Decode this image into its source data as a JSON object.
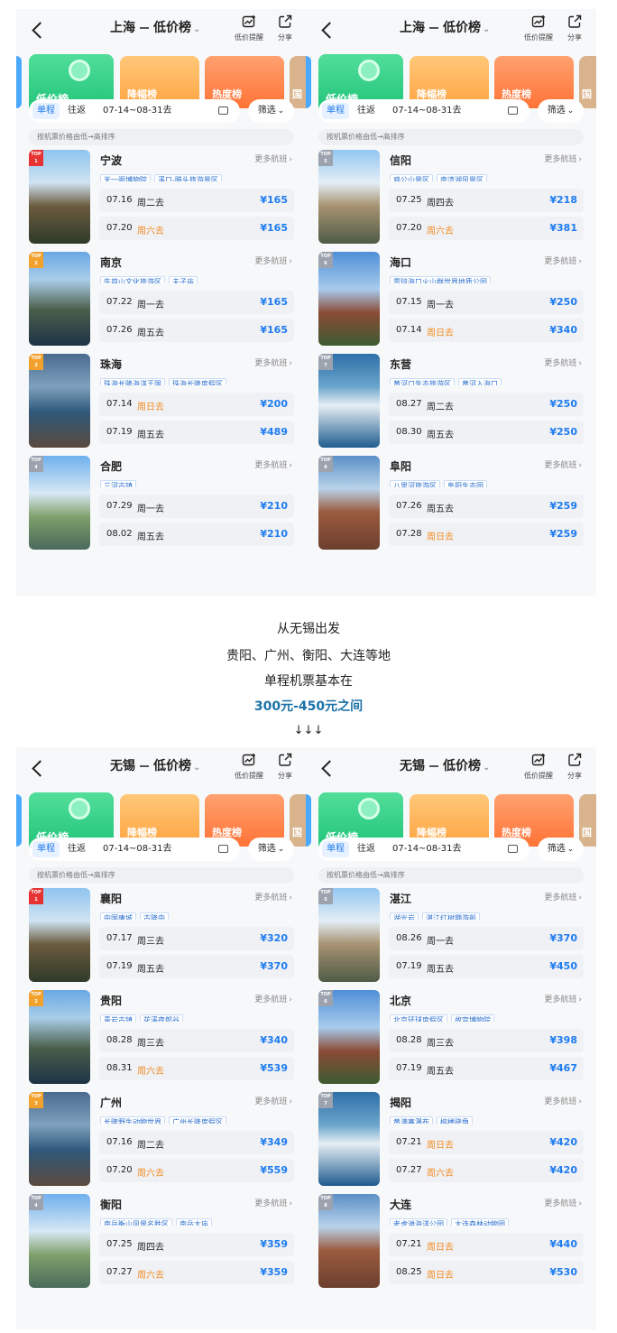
{
  "ui": {
    "rank_top": "TOP",
    "more_flights": "更多航班",
    "trip_one_way": "单程",
    "trip_round": "往返",
    "screen_label": "筛选",
    "sort_text": "按机票价格由低→高排序",
    "alert_label": "低价提醒",
    "share_label": "分享",
    "card_low": "低价榜",
    "card_drop": "降幅榜",
    "card_hot": "热度榜",
    "card_more": "国",
    "dash": "—",
    "chevron": "⌄"
  },
  "caption": {
    "line1": "从无锡出发",
    "line2": "贵阳、广州、衡阳、大连等地",
    "line3": "单程机票基本在",
    "line4": "300元-450元之间",
    "arrows": "↓↓↓"
  },
  "colors": {
    "accent": "#1f7cf0",
    "weekend": "#f38a1d",
    "highlight": "#1c72a8"
  },
  "panels": [
    {
      "id": "sh-left",
      "origin": "上海",
      "list_name": "低价榜",
      "dates": "07-14~08-31去",
      "items": [
        {
          "rank": "1",
          "city": "宁波",
          "tags": [
            "天一阁博物院",
            "溪口-滕头旅游景区"
          ],
          "flights": [
            {
              "date": "07.16",
              "weekday": "周二去",
              "price": "¥165",
              "weekend": false
            },
            {
              "date": "07.20",
              "weekday": "周六去",
              "price": "¥165",
              "weekend": true
            }
          ]
        },
        {
          "rank": "2",
          "city": "南京",
          "tags": [
            "牛首山文化旅游区",
            "夫子庙"
          ],
          "flights": [
            {
              "date": "07.22",
              "weekday": "周一去",
              "price": "¥165",
              "weekend": false
            },
            {
              "date": "07.26",
              "weekday": "周五去",
              "price": "¥165",
              "weekend": false
            }
          ]
        },
        {
          "rank": "3",
          "city": "珠海",
          "tags": [
            "珠海长隆海洋王国",
            "珠海长隆度假区"
          ],
          "flights": [
            {
              "date": "07.14",
              "weekday": "周日去",
              "price": "¥200",
              "weekend": true
            },
            {
              "date": "07.19",
              "weekday": "周五去",
              "price": "¥489",
              "weekend": false
            }
          ]
        },
        {
          "rank": "4",
          "city": "合肥",
          "tags": [
            "三河古镇"
          ],
          "flights": [
            {
              "date": "07.29",
              "weekday": "周一去",
              "price": "¥210",
              "weekend": false
            },
            {
              "date": "08.02",
              "weekday": "周五去",
              "price": "¥210",
              "weekend": false
            }
          ]
        }
      ]
    },
    {
      "id": "sh-right",
      "origin": "上海",
      "list_name": "低价榜",
      "dates": "07-14~08-31去",
      "items": [
        {
          "rank": "5",
          "city": "信阳",
          "tags": [
            "鸡公山景区",
            "南湾湖风景区"
          ],
          "flights": [
            {
              "date": "07.25",
              "weekday": "周四去",
              "price": "¥218",
              "weekend": false
            },
            {
              "date": "07.20",
              "weekday": "周六去",
              "price": "¥381",
              "weekend": true
            }
          ]
        },
        {
          "rank": "6",
          "city": "海口",
          "tags": [
            "雷琼海口火山群世界地质公园"
          ],
          "flights": [
            {
              "date": "07.15",
              "weekday": "周一去",
              "price": "¥250",
              "weekend": false
            },
            {
              "date": "07.14",
              "weekday": "周日去",
              "price": "¥340",
              "weekend": true
            }
          ]
        },
        {
          "rank": "7",
          "city": "东营",
          "tags": [
            "黄河口生态旅游区",
            "黄河入海口"
          ],
          "flights": [
            {
              "date": "08.27",
              "weekday": "周二去",
              "price": "¥250",
              "weekend": false
            },
            {
              "date": "08.30",
              "weekday": "周五去",
              "price": "¥250",
              "weekend": false
            }
          ]
        },
        {
          "rank": "8",
          "city": "阜阳",
          "tags": [
            "八里河旅游区",
            "阜阳生态园"
          ],
          "flights": [
            {
              "date": "07.26",
              "weekday": "周五去",
              "price": "¥259",
              "weekend": false
            },
            {
              "date": "07.28",
              "weekday": "周日去",
              "price": "¥259",
              "weekend": true
            }
          ]
        }
      ]
    },
    {
      "id": "wx-left",
      "origin": "无锡",
      "list_name": "低价榜",
      "dates": "07-14~08-31去",
      "items": [
        {
          "rank": "1",
          "city": "襄阳",
          "tags": [
            "中国唐城",
            "古隆中"
          ],
          "flights": [
            {
              "date": "07.17",
              "weekday": "周三去",
              "price": "¥320",
              "weekend": false
            },
            {
              "date": "07.19",
              "weekday": "周五去",
              "price": "¥370",
              "weekend": false
            }
          ]
        },
        {
          "rank": "2",
          "city": "贵阳",
          "tags": [
            "青岩古镇",
            "花溪夜郎谷"
          ],
          "flights": [
            {
              "date": "08.28",
              "weekday": "周三去",
              "price": "¥340",
              "weekend": false
            },
            {
              "date": "08.31",
              "weekday": "周六去",
              "price": "¥539",
              "weekend": true
            }
          ]
        },
        {
          "rank": "3",
          "city": "广州",
          "tags": [
            "长隆野生动物世界",
            "广州长隆度假区"
          ],
          "flights": [
            {
              "date": "07.16",
              "weekday": "周二去",
              "price": "¥349",
              "weekend": false
            },
            {
              "date": "07.20",
              "weekday": "周六去",
              "price": "¥559",
              "weekend": true
            }
          ]
        },
        {
          "rank": "4",
          "city": "衡阳",
          "tags": [
            "南岳衡山风景名胜区",
            "南岳大庙"
          ],
          "flights": [
            {
              "date": "07.25",
              "weekday": "周四去",
              "price": "¥359",
              "weekend": false
            },
            {
              "date": "07.27",
              "weekday": "周六去",
              "price": "¥359",
              "weekend": true
            }
          ]
        }
      ]
    },
    {
      "id": "wx-right",
      "origin": "无锡",
      "list_name": "低价榜",
      "dates": "07-14~08-31去",
      "items": [
        {
          "rank": "5",
          "city": "湛江",
          "tags": [
            "湖光岩",
            "湛江红树鹦游船"
          ],
          "flights": [
            {
              "date": "08.26",
              "weekday": "周一去",
              "price": "¥370",
              "weekend": false
            },
            {
              "date": "07.19",
              "weekday": "周五去",
              "price": "¥450",
              "weekend": false
            }
          ]
        },
        {
          "rank": "6",
          "city": "北京",
          "tags": [
            "北京环球度假区",
            "故宫博物院"
          ],
          "flights": [
            {
              "date": "08.28",
              "weekday": "周三去",
              "price": "¥398",
              "weekend": false
            },
            {
              "date": "07.19",
              "weekday": "周五去",
              "price": "¥467",
              "weekend": false
            }
          ]
        },
        {
          "rank": "7",
          "city": "揭阳",
          "tags": [
            "黄满寨瀑布",
            "榕楼晓角"
          ],
          "flights": [
            {
              "date": "07.21",
              "weekday": "周日去",
              "price": "¥420",
              "weekend": true
            },
            {
              "date": "07.27",
              "weekday": "周六去",
              "price": "¥420",
              "weekend": true
            }
          ]
        },
        {
          "rank": "8",
          "city": "大连",
          "tags": [
            "老虎滩海洋公园",
            "大连森林动物园"
          ],
          "flights": [
            {
              "date": "07.21",
              "weekday": "周日去",
              "price": "¥440",
              "weekend": true
            },
            {
              "date": "08.25",
              "weekday": "周日去",
              "price": "¥530",
              "weekend": true
            }
          ]
        }
      ]
    }
  ]
}
